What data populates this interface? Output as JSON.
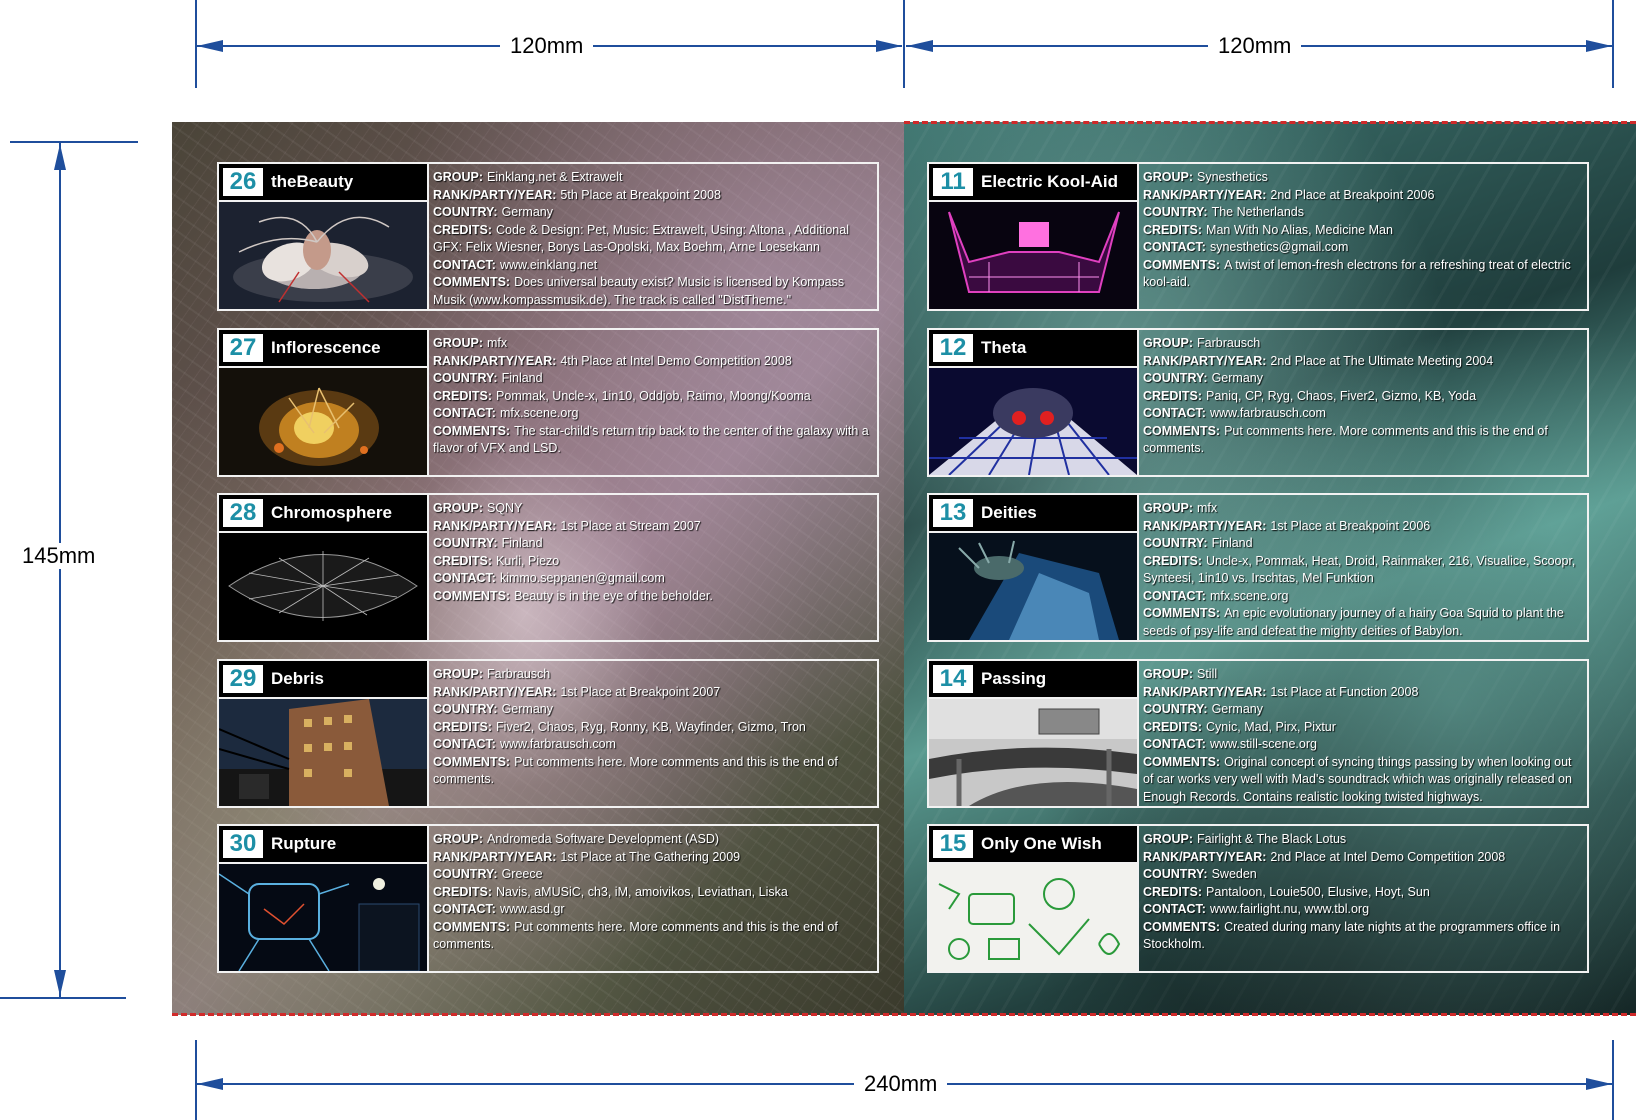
{
  "dimensions": {
    "top_left": "120mm",
    "top_right": "120mm",
    "left": "145mm",
    "bottom": "240mm"
  },
  "labels": {
    "group": "GROUP:",
    "rank": "RANK/PARTY/YEAR:",
    "country": "COUNTRY:",
    "credits": "CREDITS:",
    "contact": "CONTACT:",
    "comments": "COMMENTS:"
  },
  "colors": {
    "number_accent": "#1d8fa6",
    "dimension_line": "#1f4e9c",
    "cut_line": "#d02a2a"
  },
  "left_entries": [
    {
      "number": "26",
      "title": "theBeauty",
      "group": "Einklang.net & Extrawelt",
      "rank": "5th Place at Breakpoint 2008",
      "country": "Germany",
      "credits": "Code & Design: Pet, Music: Extrawelt, Using: Altona , Additional GFX: Felix Wiesner, Borys Las-Opolski, Max Boehm, Arne Loesekann",
      "contact": "www.einklang.net",
      "comments": "Does universal beauty exist? Music is licensed by Kompass Musik (www.kompassmusik.de). The track is called \"DistTheme.\""
    },
    {
      "number": "27",
      "title": "Inflorescence",
      "group": "mfx",
      "rank": "4th Place at Intel Demo Competition 2008",
      "country": "Finland",
      "credits": "Pommak, Uncle-x, 1in10, Oddjob, Raimo, Moong/Kooma",
      "contact": "mfx.scene.org",
      "comments": "The star-child's return trip back to the center of the galaxy with a flavor of VFX and LSD."
    },
    {
      "number": "28",
      "title": "Chromosphere",
      "group": "SQNY",
      "rank": "1st Place at Stream 2007",
      "country": "Finland",
      "credits": "Kurli, Piezo",
      "contact": "kimmo.seppanen@gmail.com",
      "comments": "Beauty is in the eye of the beholder."
    },
    {
      "number": "29",
      "title": "Debris",
      "group": "Farbrausch",
      "rank": "1st Place at Breakpoint 2007",
      "country": "Germany",
      "credits": "Fiver2, Chaos, Ryg, Ronny, KB, Wayfinder, Gizmo, Tron",
      "contact": "www.farbrausch.com",
      "comments": "Put comments here. More comments and this is the end of comments."
    },
    {
      "number": "30",
      "title": "Rupture",
      "group": "Andromeda Software Development (ASD)",
      "rank": "1st Place at The Gathering 2009",
      "country": "Greece",
      "credits": "Navis, aMUSiC, ch3, iM, amoivikos, Leviathan, Liska",
      "contact": "www.asd.gr",
      "comments": "Put comments here. More comments and this is the end of comments."
    }
  ],
  "right_entries": [
    {
      "number": "11",
      "title": "Electric Kool-Aid",
      "group": "Synesthetics",
      "rank": "2nd Place at Breakpoint 2006",
      "country": "The Netherlands",
      "credits": "Man With No Alias, Medicine Man",
      "contact": "synesthetics@gmail.com",
      "comments": "A twist of lemon-fresh electrons for a refreshing treat of electric kool-aid."
    },
    {
      "number": "12",
      "title": "Theta",
      "group": "Farbrausch",
      "rank": "2nd Place at The Ultimate Meeting 2004",
      "country": "Germany",
      "credits": "Paniq, CP, Ryg, Chaos, Fiver2, Gizmo, KB, Yoda",
      "contact": "www.farbrausch.com",
      "comments": "Put comments here. More comments and this is the end of comments."
    },
    {
      "number": "13",
      "title": "Deities",
      "group": "mfx",
      "rank": "1st Place at Breakpoint 2006",
      "country": "Finland",
      "credits": "Uncle-x, Pommak, Heat, Droid, Rainmaker, 216, Visualice, Scoopr, Synteesi, 1in10 vs. Irschtas, Mel Funktion",
      "contact": "mfx.scene.org",
      "comments": "An epic evolutionary journey of a hairy Goa Squid to plant the seeds of psy-life and defeat the mighty deities of Babylon."
    },
    {
      "number": "14",
      "title": "Passing",
      "group": "Still",
      "rank": "1st Place at Function 2008",
      "country": "Germany",
      "credits": "Cynic, Mad, Pirx, Pixtur",
      "contact": "www.still-scene.org",
      "comments": "Original concept of syncing things passing by when looking out of car works very well with Mad's soundtrack which was originally released on Enough Records. Contains realistic looking twisted highways."
    },
    {
      "number": "15",
      "title": "Only One Wish",
      "group": "Fairlight & The Black Lotus",
      "rank": "2nd Place at Intel Demo Competition 2008",
      "country": "Sweden",
      "credits": "Pantaloon, Louie500, Elusive, Hoyt, Sun",
      "contact": "www.fairlight.nu, www.tbl.org",
      "comments": "Created during many late nights at the programmers office in Stockholm."
    }
  ]
}
